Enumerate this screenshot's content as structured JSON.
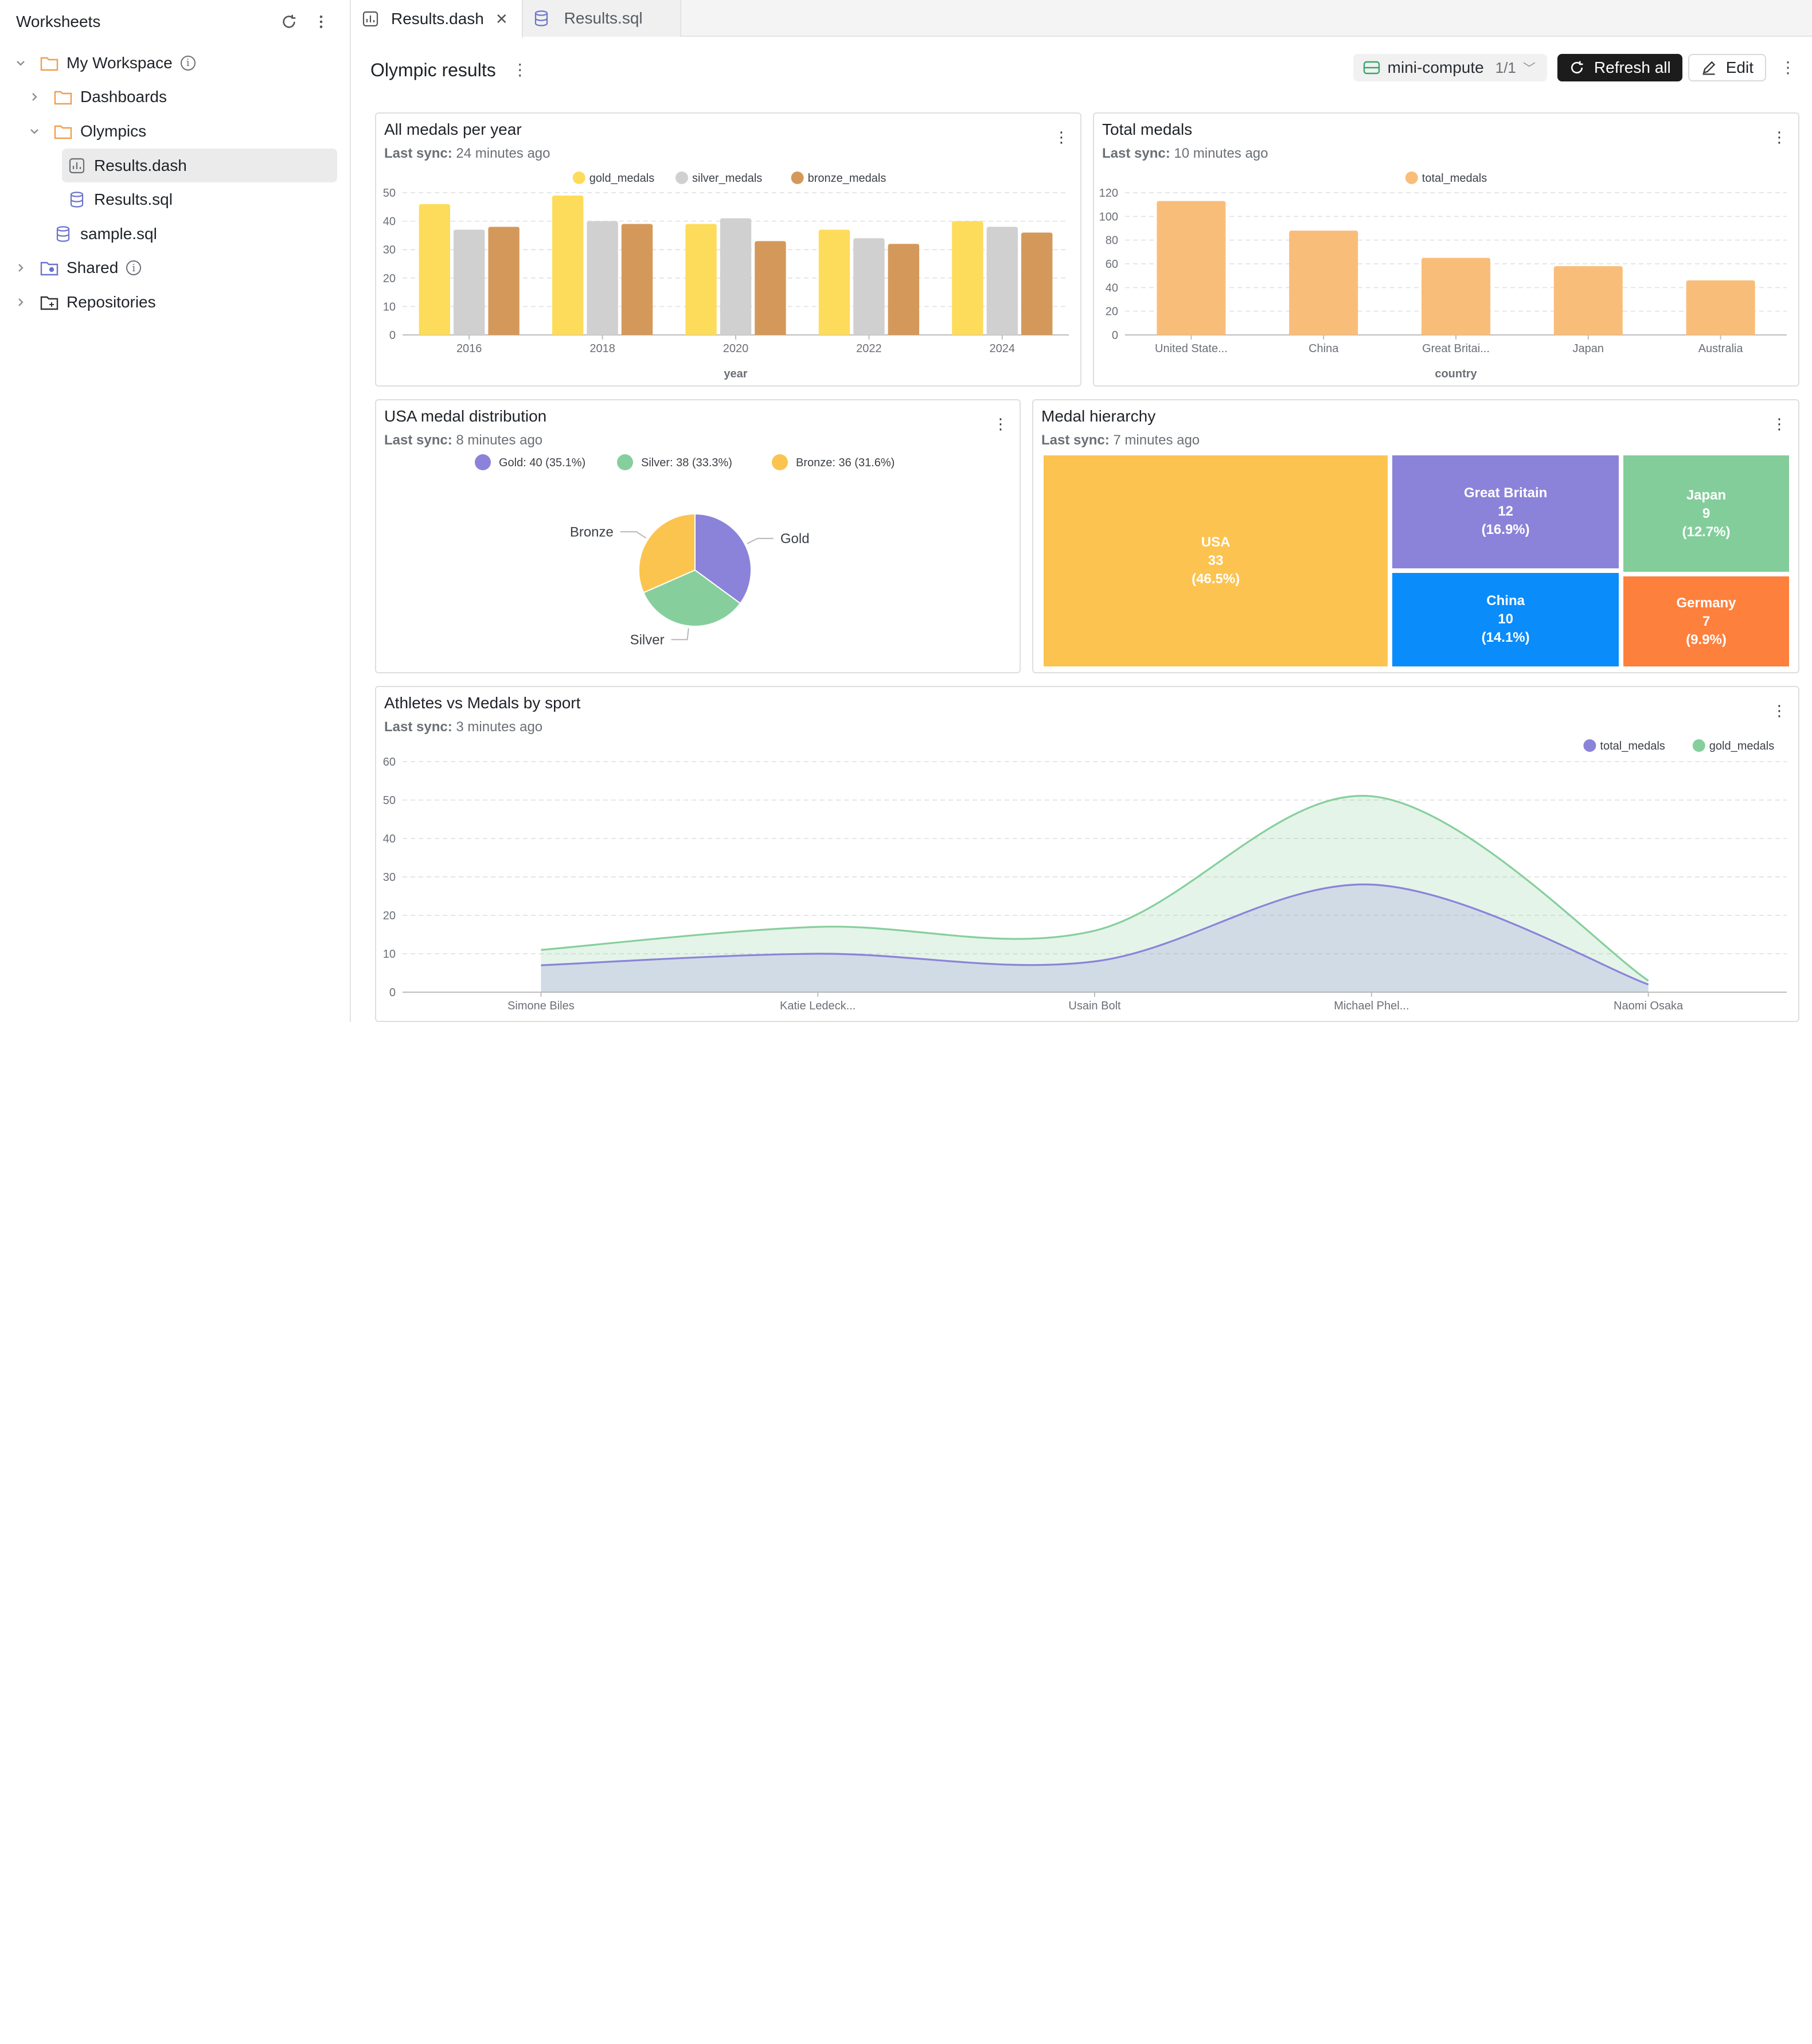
{
  "sidebar": {
    "title": "Worksheets",
    "items": [
      {
        "label": "My Workspace"
      },
      {
        "label": "Dashboards"
      },
      {
        "label": "Olympics"
      },
      {
        "label": "Results.dash"
      },
      {
        "label": "Results.sql"
      },
      {
        "label": "sample.sql"
      },
      {
        "label": "Shared"
      },
      {
        "label": "Repositories"
      }
    ]
  },
  "tabs": [
    {
      "label": "Results.dash"
    },
    {
      "label": "Results.sql"
    }
  ],
  "header": {
    "title": "Olympic results",
    "compute_name": "mini-compute",
    "compute_count": "1/1",
    "refresh_label": "Refresh all",
    "edit_label": "Edit"
  },
  "cards": {
    "medals_per_year": {
      "title": "All medals per year",
      "sync_label": "Last sync:",
      "sync_time": "24 minutes ago"
    },
    "total_medals": {
      "title": "Total medals",
      "sync_label": "Last sync:",
      "sync_time": "10 minutes ago"
    },
    "usa_dist": {
      "title": "USA medal distribution",
      "sync_label": "Last sync:",
      "sync_time": "8 minutes ago"
    },
    "hierarchy": {
      "title": "Medal hierarchy",
      "sync_label": "Last sync:",
      "sync_time": "7 minutes ago"
    },
    "athletes": {
      "title": "Athletes vs Medals by sport",
      "sync_label": "Last sync:",
      "sync_time": "3 minutes ago"
    }
  },
  "chart_data": [
    {
      "type": "bar",
      "title": "All medals per year",
      "xlabel": "year",
      "ylabel": "",
      "categories": [
        "2016",
        "2018",
        "2020",
        "2022",
        "2024"
      ],
      "series": [
        {
          "name": "gold_medals",
          "values": [
            46,
            49,
            39,
            37,
            40
          ],
          "color": "#fddc5c"
        },
        {
          "name": "silver_medals",
          "values": [
            37,
            40,
            41,
            34,
            38
          ],
          "color": "#d0d0d0"
        },
        {
          "name": "bronze_medals",
          "values": [
            38,
            39,
            33,
            32,
            36
          ],
          "color": "#d4995a"
        }
      ],
      "ylim": [
        0,
        50
      ],
      "yticks": [
        "0",
        "10",
        "20",
        "30",
        "40",
        "50"
      ],
      "legend": "top-center",
      "grid": true
    },
    {
      "type": "bar",
      "title": "Total medals",
      "xlabel": "country",
      "ylabel": "",
      "categories": [
        "United State...",
        "China",
        "Great Britai...",
        "Japan",
        "Australia"
      ],
      "series": [
        {
          "name": "total_medals",
          "values": [
            113,
            88,
            65,
            58,
            46
          ],
          "color": "#f9bd7a"
        }
      ],
      "ylim": [
        0,
        120
      ],
      "yticks": [
        "0",
        "20",
        "40",
        "60",
        "80",
        "100",
        "120"
      ],
      "legend": "top-center",
      "grid": true
    },
    {
      "type": "pie",
      "title": "USA medal distribution",
      "slices": [
        {
          "name": "Gold",
          "value": 40,
          "legend": "Gold: 40 (35.1%)",
          "color": "#8b83d9"
        },
        {
          "name": "Silver",
          "value": 38,
          "legend": "Silver: 38 (33.3%)",
          "color": "#86cf9c"
        },
        {
          "name": "Bronze",
          "value": 36,
          "legend": "Bronze: 36 (31.6%)",
          "color": "#fbc44f"
        }
      ],
      "legend": "top-center"
    },
    {
      "type": "treemap",
      "title": "Medal hierarchy",
      "nodes": [
        {
          "name": "USA",
          "value": 33,
          "pct": "(46.5%)",
          "color": "#fcc350"
        },
        {
          "name": "Great Britain",
          "value": 12,
          "pct": "(16.9%)",
          "color": "#8b83d9"
        },
        {
          "name": "China",
          "value": 10,
          "pct": "(14.1%)",
          "color": "#0a8cfb"
        },
        {
          "name": "Japan",
          "value": 9,
          "pct": "(12.7%)",
          "color": "#83cd9a"
        },
        {
          "name": "Germany",
          "value": 7,
          "pct": "(9.9%)",
          "color": "#fd803d"
        }
      ]
    },
    {
      "type": "area",
      "title": "Athletes vs Medals by sport",
      "x": [
        "Simone Biles",
        "Katie Ledeck...",
        "Usain Bolt",
        "Michael Phel...",
        "Naomi Osaka"
      ],
      "series": [
        {
          "name": "total_medals",
          "values": [
            7,
            10,
            8,
            28,
            2
          ],
          "color": "#8b83d9"
        },
        {
          "name": "gold_medals",
          "values": [
            11,
            17,
            16,
            51,
            3
          ],
          "color": "#86cf9c"
        }
      ],
      "ylim": [
        0,
        60
      ],
      "yticks": [
        "0",
        "10",
        "20",
        "30",
        "40",
        "50",
        "60"
      ],
      "legend": "top-right",
      "grid": true
    }
  ]
}
